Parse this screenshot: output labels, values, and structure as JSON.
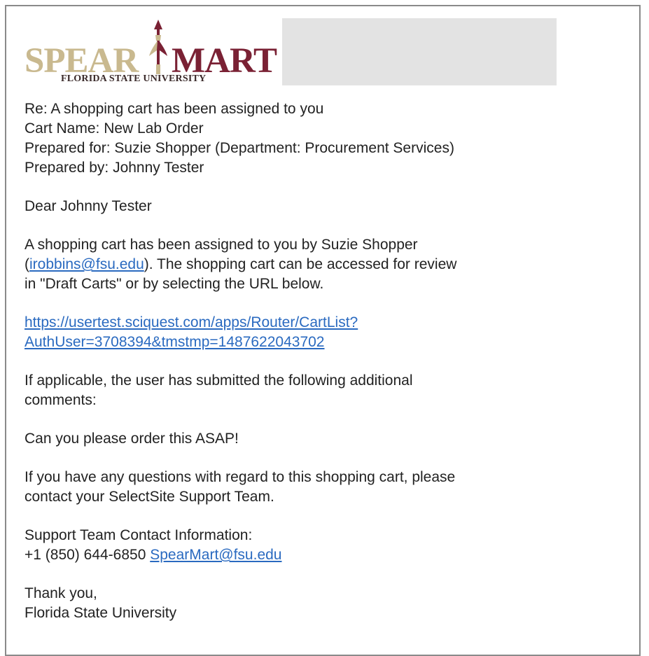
{
  "logo": {
    "spear": "SPEAR",
    "mart": "MART",
    "university": "FLORIDA STATE UNIVERSITY",
    "spear_color": "#c9b98f",
    "mart_color": "#7a2134"
  },
  "email": {
    "header": {
      "subject": "Re: A shopping cart has been assigned to you",
      "cart_name": "Cart Name: New Lab Order",
      "prepared_for": "Prepared for: Suzie Shopper (Department: Procurement Services)",
      "prepared_by": "Prepared by: Johnny Tester"
    },
    "greeting": "Dear Johnny Tester",
    "body1_before": "A shopping cart has been assigned to you by Suzie Shopper",
    "body1_paren_open": "(",
    "body1_email": "irobbins@fsu.edu",
    "body1_after_email": "). The shopping cart can be accessed for review",
    "body1_line3": "in \"Draft Carts\" or by selecting the URL below.",
    "url_line1": "https://usertest.sciquest.com/apps/Router/CartList?",
    "url_line2": "AuthUser=3708394&tmstmp=1487622043702",
    "comments_line1": "If applicable, the user has submitted the following additional",
    "comments_line2": "comments:",
    "comment": "Can you please order this ASAP!",
    "questions_line1": "If you have any questions with regard to this shopping cart, please",
    "questions_line2": "contact your SelectSite Support Team.",
    "support_title": "Support Team Contact Information:",
    "support_phone": "+1 (850) 644-6850",
    "support_email": "SpearMart@fsu.edu",
    "closing": "Thank you,",
    "signature": "Florida State University"
  }
}
